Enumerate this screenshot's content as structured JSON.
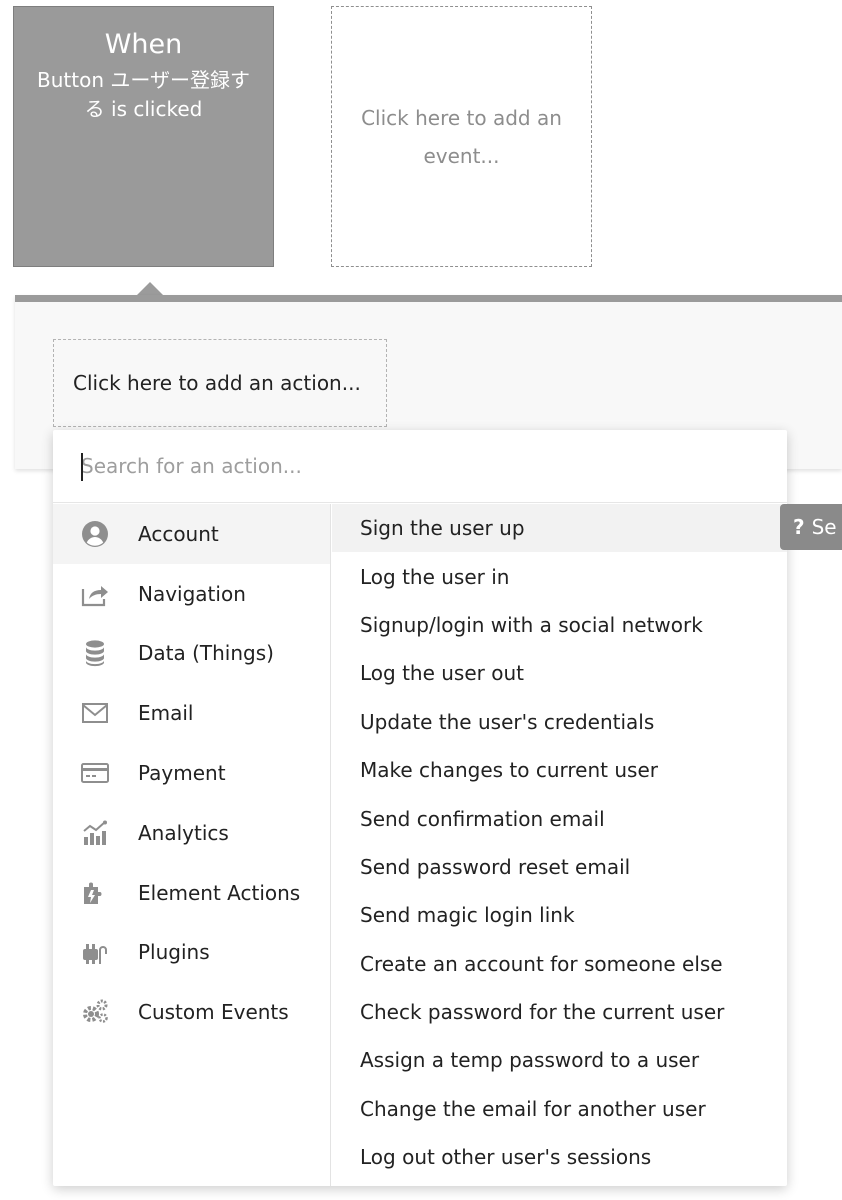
{
  "event_card": {
    "when": "When",
    "trigger": "Button ユーザー登録する is clicked"
  },
  "add_event": {
    "label": "Click here to add an event..."
  },
  "add_action": {
    "label": "Click here to add an action..."
  },
  "search": {
    "placeholder": "Search for an action..."
  },
  "categories": [
    {
      "label": "Account",
      "icon": "user-circle-icon"
    },
    {
      "label": "Navigation",
      "icon": "share-icon"
    },
    {
      "label": "Data (Things)",
      "icon": "database-icon"
    },
    {
      "label": "Email",
      "icon": "envelope-icon"
    },
    {
      "label": "Payment",
      "icon": "credit-card-icon"
    },
    {
      "label": "Analytics",
      "icon": "chart-icon"
    },
    {
      "label": "Element Actions",
      "icon": "puzzle-icon"
    },
    {
      "label": "Plugins",
      "icon": "plug-icon"
    },
    {
      "label": "Custom Events",
      "icon": "gears-icon"
    }
  ],
  "actions": [
    "Sign the user up",
    "Log the user in",
    "Signup/login with a social network",
    "Log the user out",
    "Update the user's credentials",
    "Make changes to current user",
    "Send confirmation email",
    "Send password reset email",
    "Send magic login link",
    "Create an account for someone else",
    "Check password for the current user",
    "Assign a temp password to a user",
    "Change the email for another user",
    "Log out other user's sessions"
  ],
  "help_badge": {
    "icon": "?",
    "label": "Se"
  },
  "colors": {
    "event_card_bg": "#9a9a9a",
    "panel_border": "#9b9b9b",
    "help_badge_bg": "#8a8a8a"
  }
}
